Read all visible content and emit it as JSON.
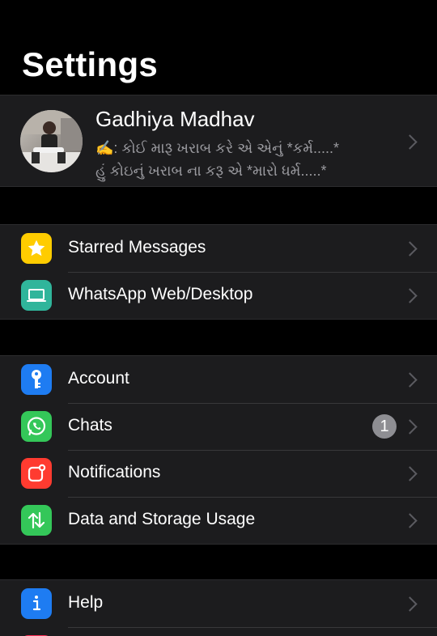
{
  "header": {
    "title": "Settings"
  },
  "profile": {
    "name": "Gadhiya Madhav",
    "status": "✍️: કોઈ મારૂ ખરાબ કરે એ એનું *કર્મ.....*\nહું કોઇનું ખરાબ ના કરૂ એ *મારો ધર્મ.....*"
  },
  "groups": [
    {
      "items": [
        {
          "label": "Starred Messages",
          "icon": "star-icon",
          "color": "#ffcc00"
        },
        {
          "label": "WhatsApp Web/Desktop",
          "icon": "laptop-icon",
          "color": "#30b59b"
        }
      ]
    },
    {
      "items": [
        {
          "label": "Account",
          "icon": "key-icon",
          "color": "#1e7cf2"
        },
        {
          "label": "Chats",
          "icon": "whatsapp-icon",
          "color": "#34c759",
          "badge": "1"
        },
        {
          "label": "Notifications",
          "icon": "notification-icon",
          "color": "#ff3b30"
        },
        {
          "label": "Data and Storage Usage",
          "icon": "data-arrows-icon",
          "color": "#34c759"
        }
      ]
    },
    {
      "items": [
        {
          "label": "Help",
          "icon": "info-icon",
          "color": "#1e7cf2"
        }
      ]
    }
  ]
}
